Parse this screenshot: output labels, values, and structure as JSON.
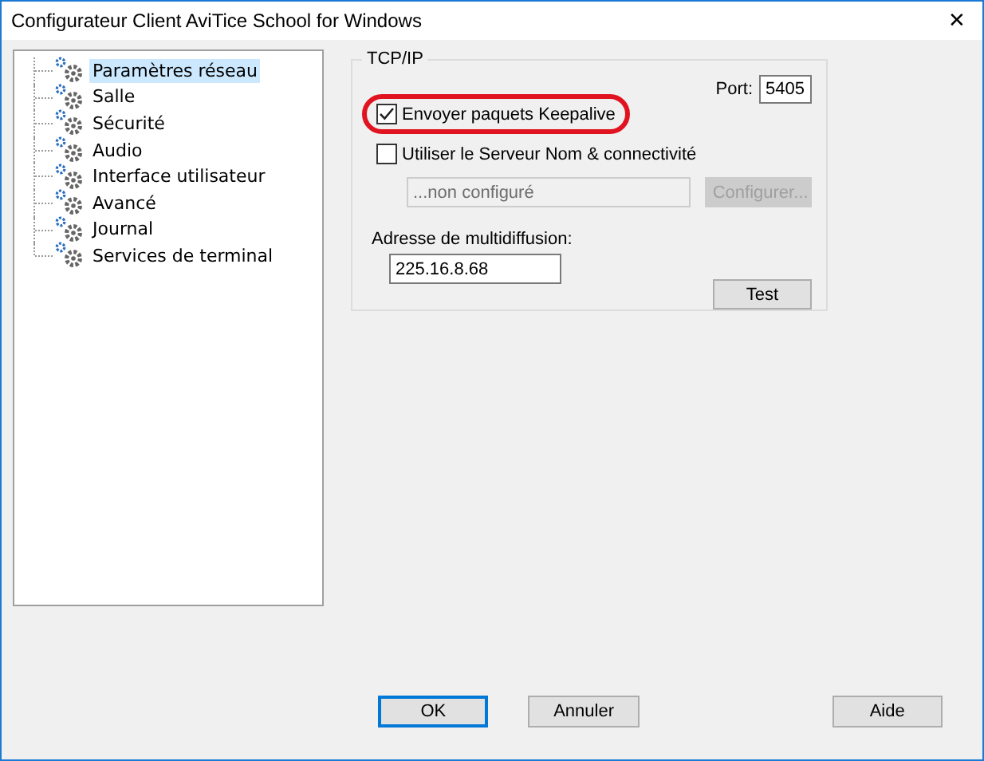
{
  "window": {
    "title": "Configurateur Client AviTice School for Windows",
    "close": "✕"
  },
  "tree": [
    {
      "label": "Paramètres réseau",
      "selected": true
    },
    {
      "label": "Salle",
      "selected": false
    },
    {
      "label": "Sécurité",
      "selected": false
    },
    {
      "label": "Audio",
      "selected": false
    },
    {
      "label": "Interface utilisateur",
      "selected": false
    },
    {
      "label": "Avancé",
      "selected": false
    },
    {
      "label": "Journal",
      "selected": false
    },
    {
      "label": "Services de terminal",
      "selected": false
    }
  ],
  "group": {
    "title": "TCP/IP",
    "port": {
      "label": "Port:",
      "value": "5405"
    },
    "checkboxes": [
      {
        "label": "Envoyer paquets Keepalive",
        "checked": true,
        "highlighted": true
      },
      {
        "label": "Utiliser le Serveur Nom & connectivité",
        "checked": false,
        "highlighted": false
      }
    ],
    "server": {
      "placeholder": "...non configuré",
      "disabled": true,
      "button": "Configurer..."
    },
    "multicast": {
      "label": "Adresse de multidiffusion:",
      "value": "225.16.8.68"
    },
    "test_button": "Test"
  },
  "buttons": [
    {
      "label": "OK",
      "default": true
    },
    {
      "label": "Annuler",
      "default": false
    },
    {
      "label": "Aide",
      "default": false
    }
  ]
}
